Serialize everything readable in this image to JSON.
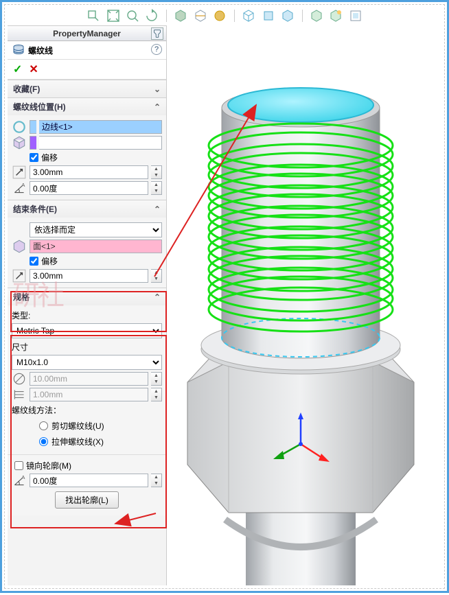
{
  "propertyManager": {
    "title": "PropertyManager"
  },
  "feature": {
    "name": "螺纹线",
    "help": "?"
  },
  "favorites": {
    "label": "收藏(F)"
  },
  "threadPosition": {
    "label": "螺纹线位置(H)",
    "edge_selected": "边线<1>",
    "offset_label": "偏移",
    "offset_value": "3.00mm",
    "angle_value": "0.00度"
  },
  "endCondition": {
    "label": "结束条件(E)",
    "type": "依选择而定",
    "face_selected": "面<1>",
    "offset_label": "偏移",
    "offset_value": "3.00mm"
  },
  "spec": {
    "label": "规格",
    "type_label": "类型:",
    "type_value": "Metric Tap",
    "size_label": "尺寸",
    "size_value": "M10x1.0",
    "major_dia": "10.00mm",
    "pitch": "1.00mm",
    "method_label": "螺纹线方法：",
    "method_cut": "剪切螺纹线(U)",
    "method_extrude": "拉伸螺纹线(X)"
  },
  "mirror": {
    "label": "镜向轮廓(M)"
  },
  "rotation_angle": "0.00度",
  "find_profile_btn": "找出轮廓(L)"
}
